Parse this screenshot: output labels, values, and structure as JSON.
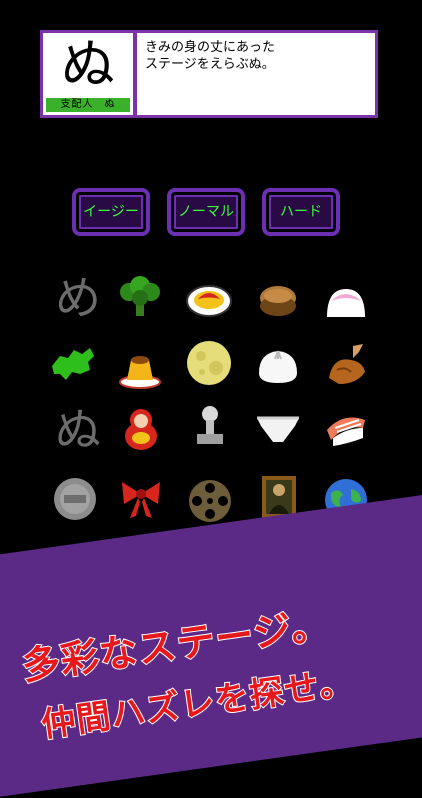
{
  "dialog": {
    "portrait_char": "ぬ",
    "nameplate": "支配人　ぬ",
    "message_lines": [
      "きみの身の丈にあった",
      "ステージをえらぶぬ。"
    ]
  },
  "difficulty": {
    "easy": "イージー",
    "normal": "ノーマル",
    "hard": "ハード"
  },
  "stage_grid": {
    "row1": [
      "め",
      "broccoli",
      "omelette-rice",
      "dorayaki",
      "mochi"
    ],
    "row2": [
      "shikoku-map",
      "pudding",
      "full-moon",
      "nikuman",
      "roast-chicken"
    ],
    "row3": [
      "ぬ",
      "matryoshka",
      "stamp",
      "underpants",
      "salmon-sushi"
    ],
    "row4": [
      "500-yen-coin",
      "red-ribbon",
      "film-reel",
      "mona-lisa-painting",
      "earth"
    ]
  },
  "banner": {
    "line1": "多彩なステージ。",
    "line2": "仲間ハズレを探せ。"
  },
  "colors": {
    "accent_purple": "#6b2fb3",
    "button_text_green": "#39ff39",
    "nameplate_green": "#3bb02a",
    "banner_red": "#e6181c"
  }
}
